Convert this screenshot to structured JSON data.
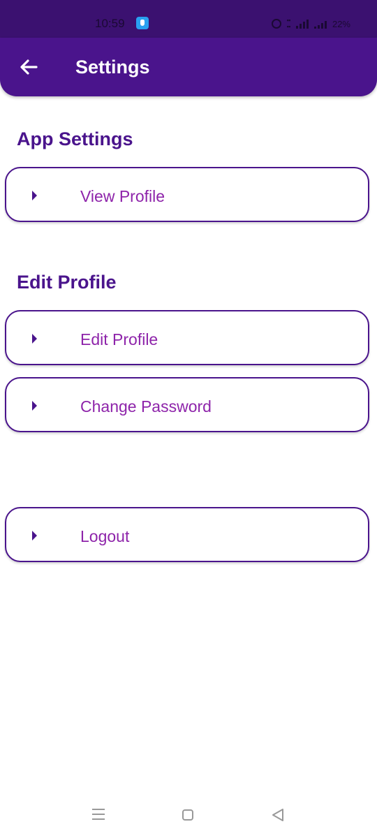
{
  "status_bar": {
    "time": "10:59",
    "battery": "22%",
    "icons": [
      "app-notification-icon",
      "alarm-icon",
      "volte-icon",
      "signal-icon",
      "battery-icon"
    ]
  },
  "app_bar": {
    "title": "Settings",
    "back_icon": "arrow-left-icon",
    "color": "#4a148c"
  },
  "sections": [
    {
      "title": "App Settings",
      "items": [
        {
          "label": "View Profile"
        }
      ]
    },
    {
      "title": "Edit Profile",
      "items": [
        {
          "label": "Edit Profile"
        },
        {
          "label": "Change Password"
        }
      ]
    }
  ],
  "logout": {
    "label": "Logout"
  },
  "colors": {
    "primary": "#4a148c",
    "item_text": "#8e24aa",
    "status_bar": "#3b1170"
  },
  "nav_bar": {
    "icons": [
      "menu-icon",
      "home-icon",
      "back-icon"
    ]
  }
}
